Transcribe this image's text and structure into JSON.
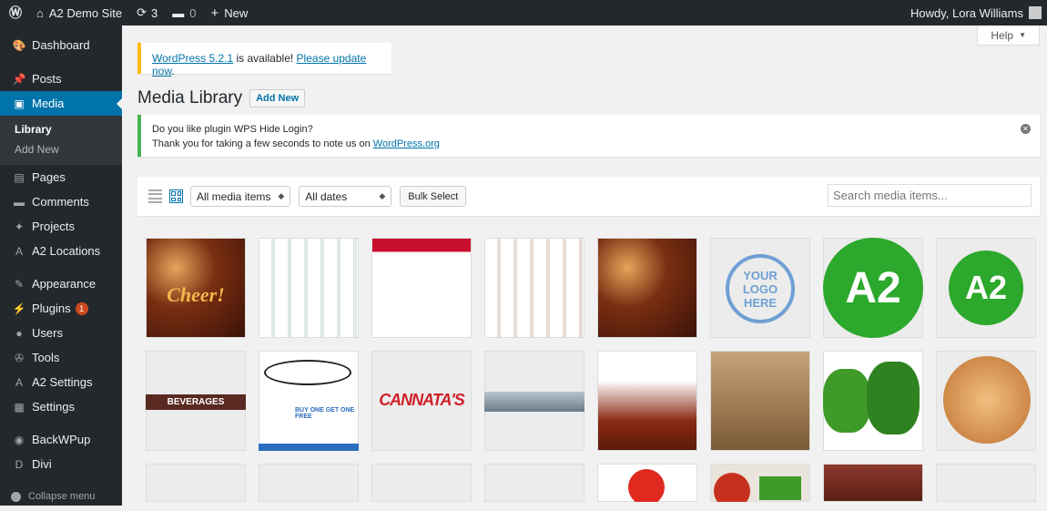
{
  "adminbar": {
    "site_name": "A2 Demo Site",
    "updates_count": "3",
    "comments_count": "0",
    "new_label": "New",
    "greeting": "Howdy, Lora Williams"
  },
  "sidebar": {
    "items": [
      {
        "label": "Dashboard",
        "icon": "dashboard-icon",
        "glyph": "🎨"
      },
      {
        "label": "Posts",
        "icon": "pin-icon",
        "glyph": "📌"
      },
      {
        "label": "Media",
        "icon": "media-icon",
        "glyph": "▣"
      },
      {
        "label": "Pages",
        "icon": "page-icon",
        "glyph": "▤"
      },
      {
        "label": "Comments",
        "icon": "comment-icon",
        "glyph": "▬"
      },
      {
        "label": "Projects",
        "icon": "pin-icon",
        "glyph": "✦"
      },
      {
        "label": "A2 Locations",
        "icon": "a2-icon",
        "glyph": "A"
      },
      {
        "label": "Appearance",
        "icon": "brush-icon",
        "glyph": "✎"
      },
      {
        "label": "Plugins",
        "icon": "plug-icon",
        "glyph": "⚡",
        "badge": "1"
      },
      {
        "label": "Users",
        "icon": "user-icon",
        "glyph": "●"
      },
      {
        "label": "Tools",
        "icon": "wrench-icon",
        "glyph": "✇"
      },
      {
        "label": "A2 Settings",
        "icon": "a2-icon",
        "glyph": "A"
      },
      {
        "label": "Settings",
        "icon": "settings-icon",
        "glyph": "▦"
      },
      {
        "label": "BackWPup",
        "icon": "backup-icon",
        "glyph": "◉"
      },
      {
        "label": "Divi",
        "icon": "divi-icon",
        "glyph": "D"
      }
    ],
    "submenu": [
      "Library",
      "Add New"
    ],
    "collapse": "Collapse menu"
  },
  "help_label": "Help",
  "update_notice": {
    "link1": "WordPress 5.2.1",
    "middle": "is available!",
    "link2": "Please update now",
    "end": "."
  },
  "page_title": "Media Library",
  "add_new": "Add New",
  "plugin_notice": {
    "line1": "Do you like plugin WPS Hide Login?",
    "line2_prefix": "Thank you for taking a few seconds to note us on",
    "line2_link": "WordPress.org"
  },
  "toolbar": {
    "media_filter": "All media items",
    "date_filter": "All dates",
    "bulk_select": "Bulk Select",
    "search_placeholder": "Search media items..."
  },
  "tiles": [
    {
      "kind": "cheer",
      "caption": "Cheer!"
    },
    {
      "kind": "flyer"
    },
    {
      "kind": "bottles"
    },
    {
      "kind": "flyer2"
    },
    {
      "kind": "cheer2"
    },
    {
      "kind": "logo",
      "caption": "YOUR LOGO HERE"
    },
    {
      "kind": "a2",
      "caption": "A2"
    },
    {
      "kind": "a2small",
      "caption": "A2"
    },
    {
      "kind": "beverages",
      "caption": "BEVERAGES"
    },
    {
      "kind": "coupon",
      "caption": "BUY ONE GET ONE FREE"
    },
    {
      "kind": "cannatas",
      "caption": "CANNATA'S"
    },
    {
      "kind": "keyboard"
    },
    {
      "kind": "liquor"
    },
    {
      "kind": "grocery"
    },
    {
      "kind": "peppers"
    },
    {
      "kind": "chicken"
    },
    {
      "kind": "blank"
    },
    {
      "kind": "blank"
    },
    {
      "kind": "blank"
    },
    {
      "kind": "blank"
    },
    {
      "kind": "pin"
    },
    {
      "kind": "veggies"
    },
    {
      "kind": "steak"
    },
    {
      "kind": "blank"
    }
  ]
}
